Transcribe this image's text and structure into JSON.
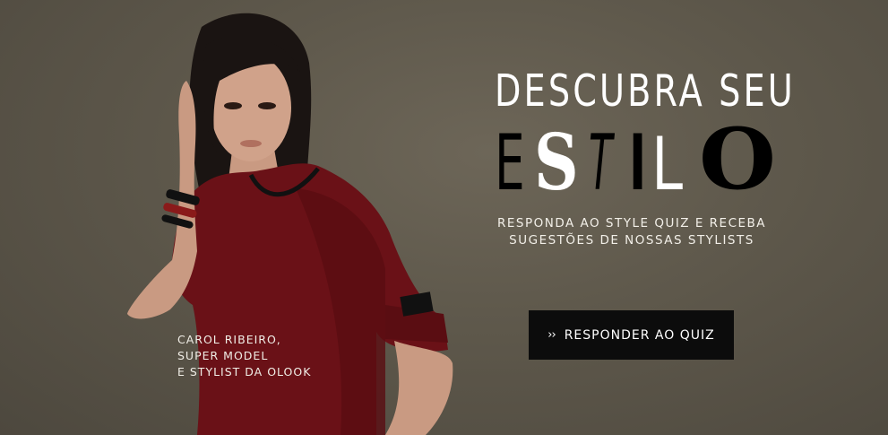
{
  "hero": {
    "headline_line1": "DESCUBRA SEU",
    "headline_word": [
      "E",
      "S",
      "T",
      "I",
      "L",
      "O"
    ],
    "subtitle": [
      "RESPONDA AO STYLE QUIZ E RECEBA",
      "SUGESTÕES DE NOSSAS STYLISTS"
    ],
    "cta_label": "RESPONDER AO QUIZ",
    "cta_icon": "double-chevron-right-icon",
    "caption": [
      "CAROL RIBEIRO,",
      "SUPER MODEL",
      "E STYLIST DA OLOOK"
    ]
  },
  "colors": {
    "background": "#5f594c",
    "button": "#0c0c0c",
    "blouse": "#6a1117",
    "text": "#ffffff"
  }
}
